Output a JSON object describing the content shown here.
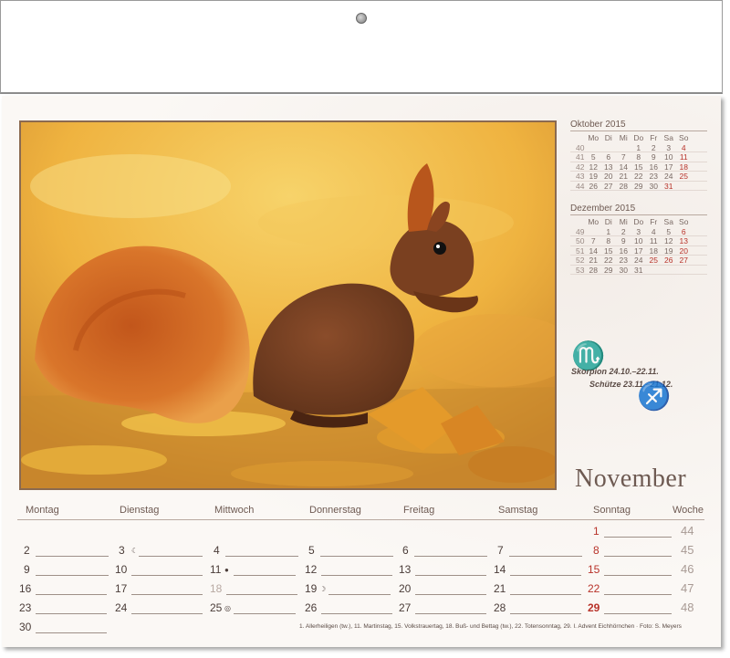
{
  "calendar": {
    "month": "November",
    "weekdays": [
      "Montag",
      "Dienstag",
      "Mittwoch",
      "Donnerstag",
      "Freitag",
      "Samstag",
      "Sonntag",
      "Woche"
    ],
    "weeks": [
      {
        "days": [
          "",
          "",
          "",
          "",
          "",
          "",
          "1"
        ],
        "week": "44"
      },
      {
        "days": [
          "2",
          "3",
          "4",
          "5",
          "6",
          "7",
          "8"
        ],
        "week": "45"
      },
      {
        "days": [
          "9",
          "10",
          "11",
          "12",
          "13",
          "14",
          "15"
        ],
        "week": "46"
      },
      {
        "days": [
          "16",
          "17",
          "18",
          "19",
          "20",
          "21",
          "22"
        ],
        "week": "47"
      },
      {
        "days": [
          "23",
          "24",
          "25",
          "26",
          "27",
          "28",
          "29"
        ],
        "week": "48"
      },
      {
        "days": [
          "30",
          "",
          "",
          "",
          "",
          "",
          ""
        ],
        "week": ""
      }
    ],
    "moon_phases": {
      "d3": "☾",
      "d11": "●",
      "d19": "☽",
      "d25": "◎"
    }
  },
  "mini_oktober": {
    "title": "Oktober 2015",
    "head": [
      "",
      "Mo",
      "Di",
      "Mi",
      "Do",
      "Fr",
      "Sa",
      "So"
    ],
    "rows": [
      [
        "40",
        "",
        "",
        "",
        "1",
        "2",
        "3",
        "4"
      ],
      [
        "41",
        "5",
        "6",
        "7",
        "8",
        "9",
        "10",
        "11"
      ],
      [
        "42",
        "12",
        "13",
        "14",
        "15",
        "16",
        "17",
        "18"
      ],
      [
        "43",
        "19",
        "20",
        "21",
        "22",
        "23",
        "24",
        "25"
      ],
      [
        "44",
        "26",
        "27",
        "28",
        "29",
        "30",
        "31",
        ""
      ]
    ]
  },
  "mini_dezember": {
    "title": "Dezember 2015",
    "head": [
      "",
      "Mo",
      "Di",
      "Mi",
      "Do",
      "Fr",
      "Sa",
      "So"
    ],
    "rows": [
      [
        "49",
        "",
        "1",
        "2",
        "3",
        "4",
        "5",
        "6"
      ],
      [
        "50",
        "7",
        "8",
        "9",
        "10",
        "11",
        "12",
        "13"
      ],
      [
        "51",
        "14",
        "15",
        "16",
        "17",
        "18",
        "19",
        "20"
      ],
      [
        "52",
        "21",
        "22",
        "23",
        "24",
        "25",
        "26",
        "27"
      ],
      [
        "53",
        "28",
        "29",
        "30",
        "31",
        "",
        "",
        ""
      ]
    ]
  },
  "zodiac": {
    "scorpio": "Skorpion 24.10.–22.11.",
    "sagittarius": "Schütze 23.11.–21.12."
  },
  "footnote": "1. Allerheiligen (tw.),  11. Martinstag,  15. Volkstrauertag,  18. Buß- und Bettag (tw.),  22. Totensonntag,  29. I. Advent   Eichhörnchen · Foto: S. Meyers",
  "colors": {
    "holiday": "#b8332a",
    "text": "#5a4a44",
    "photo_border": "#8b6a50"
  }
}
